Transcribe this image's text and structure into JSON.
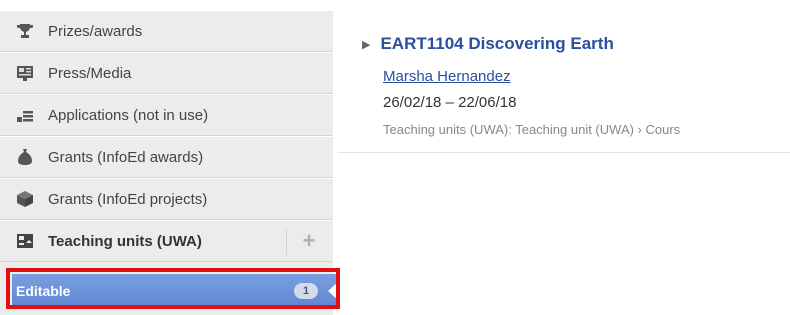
{
  "sidebar": {
    "items": [
      {
        "label": "Prizes/awards",
        "icon": "trophy-icon"
      },
      {
        "label": "Press/Media",
        "icon": "press-icon"
      },
      {
        "label": "Applications (not in use)",
        "icon": "applications-icon"
      },
      {
        "label": "Grants (InfoEd awards)",
        "icon": "money-bag-icon"
      },
      {
        "label": "Grants (InfoEd projects)",
        "icon": "box-icon"
      },
      {
        "label": "Teaching units (UWA)",
        "icon": "teaching-unit-icon",
        "add": "+"
      }
    ],
    "sub_item": {
      "label": "Editable",
      "count": "1"
    }
  },
  "result": {
    "caret": "▶",
    "title": "EART1104 Discovering Earth",
    "author": "Marsha Hernandez",
    "dates": "26/02/18 – 22/06/18",
    "path": "Teaching units (UWA): Teaching unit (UWA) › Cours"
  },
  "colors": {
    "sidebar_bg": "#ececec",
    "link": "#2a4f9f",
    "selected_bg": "#6a90d8",
    "highlight": "#e01010"
  }
}
